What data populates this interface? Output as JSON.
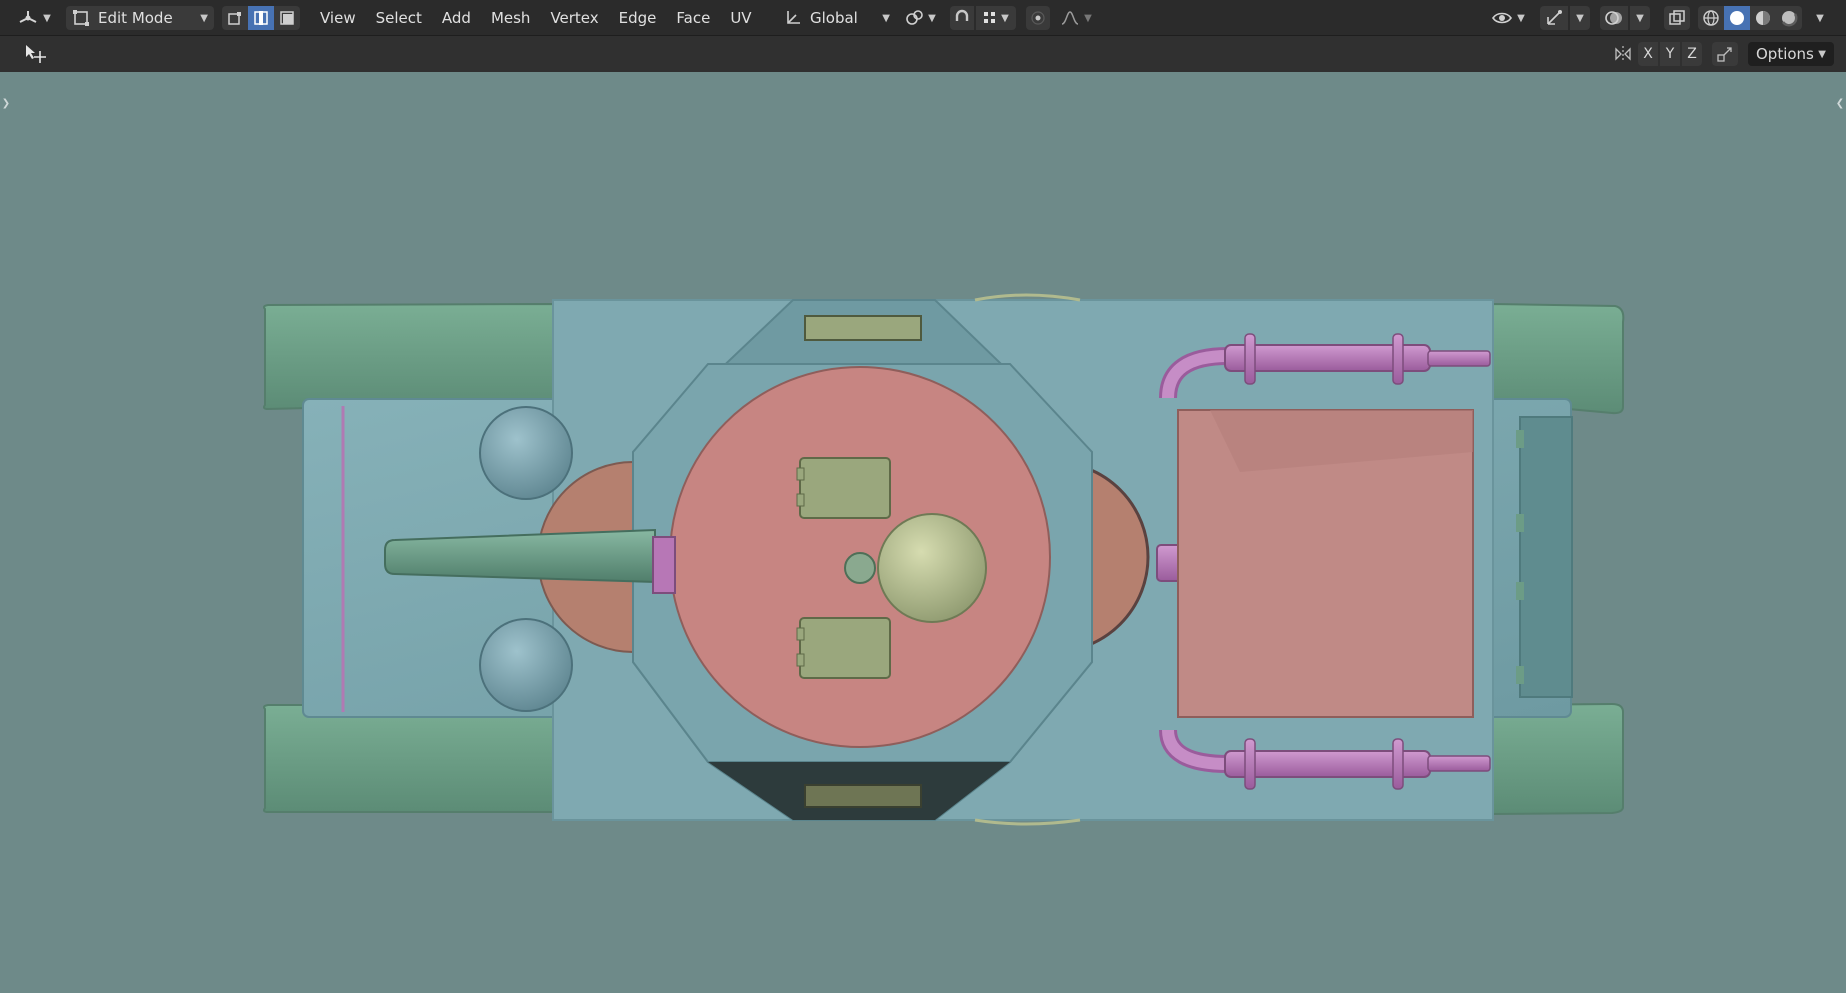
{
  "header": {
    "editor_type_icon": "viewport-editor-icon",
    "mode": {
      "label": "Edit Mode",
      "icon": "edit-mode-icon"
    },
    "select_modes": [
      "vertex-select-icon",
      "edge-select-icon",
      "face-select-icon"
    ],
    "active_select_mode": "edge",
    "menus": [
      "View",
      "Select",
      "Add",
      "Mesh",
      "Vertex",
      "Edge",
      "Face",
      "UV"
    ],
    "transform_orientation": "Global",
    "pivot_icon": "pivot-point-icon",
    "snap_icon": "snap-magnet-icon",
    "snap_target_icon": "snap-increment-icon",
    "proportional_icon": "proportional-edit-icon",
    "falloff_icon": "falloff-curve-icon",
    "right_icons": [
      "visibility-eye-icon",
      "gizmo-icon",
      "overlay-icon",
      "xray-icon",
      "wireframe-shading-icon",
      "solid-shading-icon",
      "material-shading-icon",
      "rendered-shading-icon"
    ],
    "active_shading": "solid"
  },
  "tool_header": {
    "tool_icon": "move-tool-icon",
    "mirror_icon": "mirror-icon",
    "axes": [
      "X",
      "Y",
      "Z"
    ],
    "autoscale_icon": "auto-scale-icon",
    "options_label": "Options"
  },
  "colors": {
    "header_bg": "#2b2b2b",
    "toolheader_bg": "#303030",
    "viewport_bg": "#6e8a89",
    "accent": "#4772b3",
    "hull": "#79a3ab",
    "track": "#6c9c86",
    "turret": "#c78582",
    "barrel": "#6c9b86",
    "dome": "#b0ba8e",
    "pipe": "#b777b6",
    "hatch": "#9aa77d"
  }
}
